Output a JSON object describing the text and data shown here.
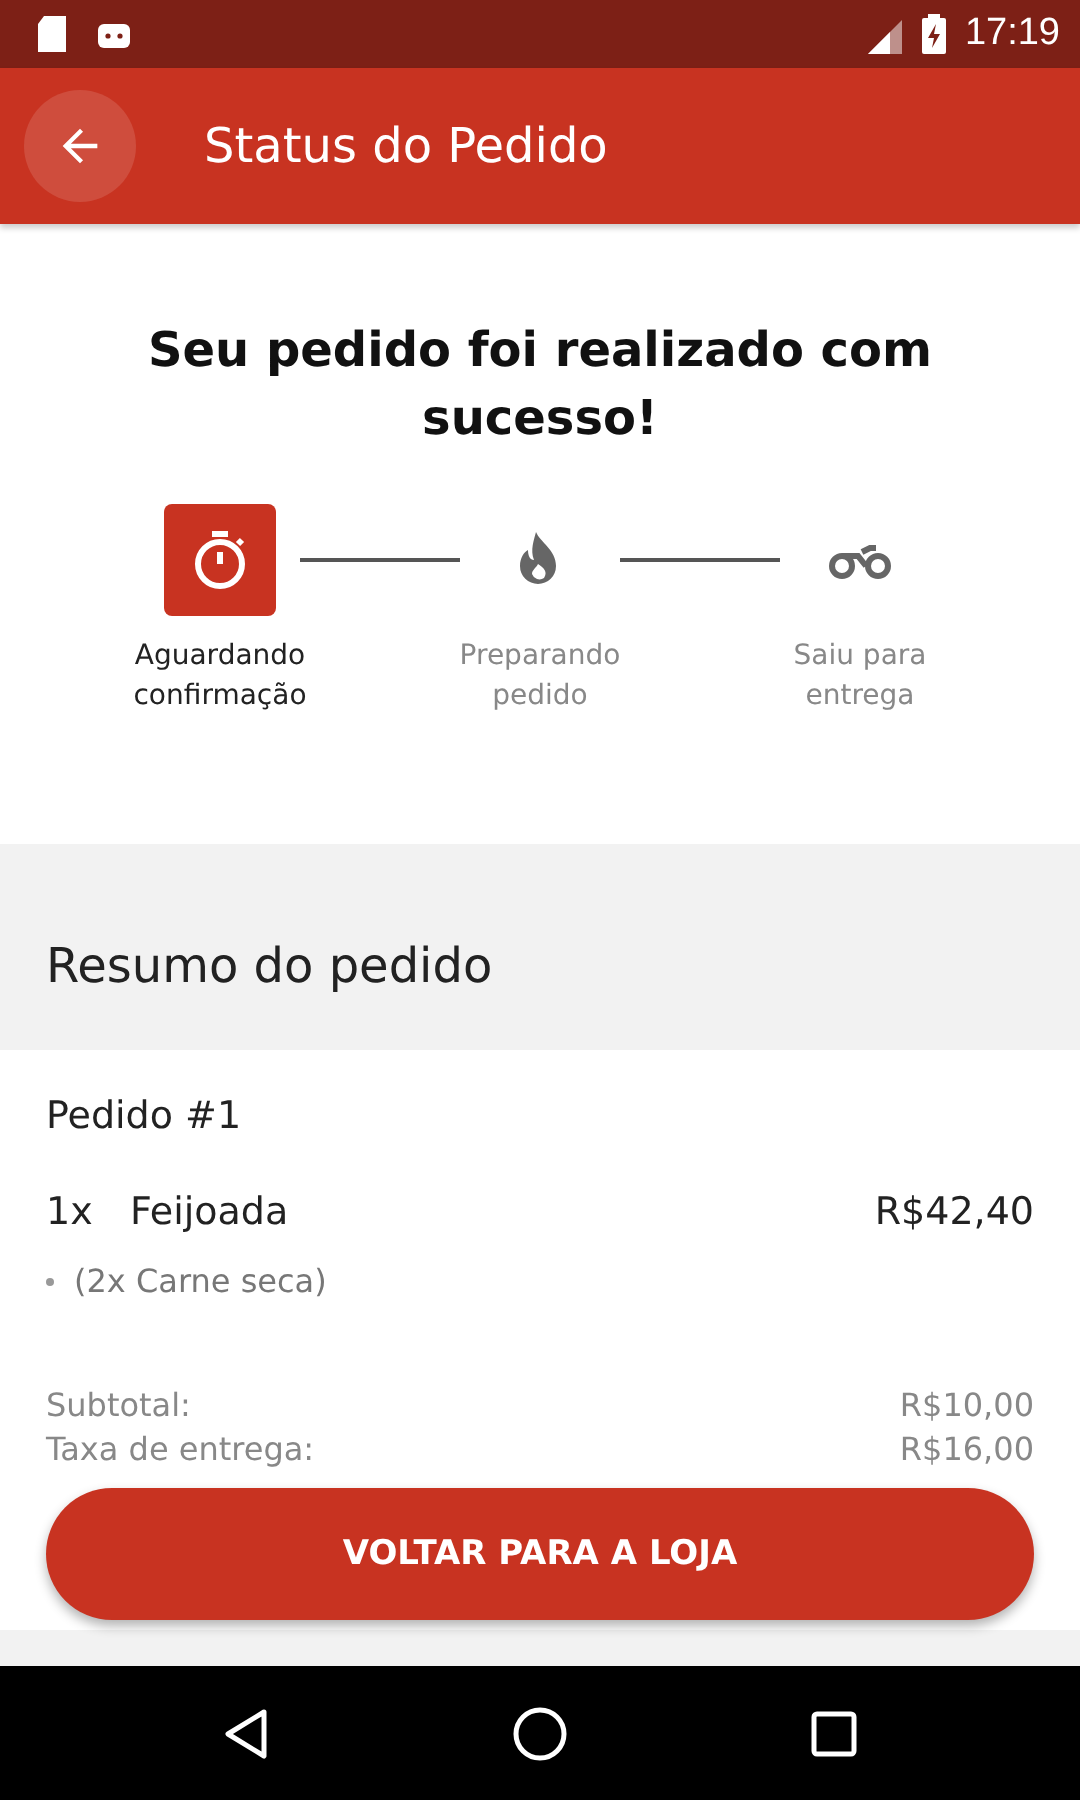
{
  "status_bar": {
    "time": "17:19"
  },
  "app_bar": {
    "title": "Status do Pedido"
  },
  "headline": "Seu pedido foi realizado com sucesso!",
  "steps": [
    {
      "kind": "timer",
      "label": "Aguardando confirmação",
      "selected": true
    },
    {
      "kind": "flame",
      "label": "Preparando pedido",
      "selected": false
    },
    {
      "kind": "motorcycle",
      "label": "Saiu para entrega",
      "selected": false
    }
  ],
  "summary": {
    "title": "Resumo do pedido",
    "order": "Pedido #1",
    "items": [
      {
        "qty": "1x",
        "name": "Feijoada",
        "price": "R$42,40",
        "extras": [
          "(2x Carne seca)"
        ]
      }
    ],
    "totals": [
      {
        "label": "Subtotal:",
        "value": "R$10,00"
      },
      {
        "label": "Taxa de entrega:",
        "value": "R$16,00"
      }
    ]
  },
  "button": "VOLTAR PARA A LOJA"
}
